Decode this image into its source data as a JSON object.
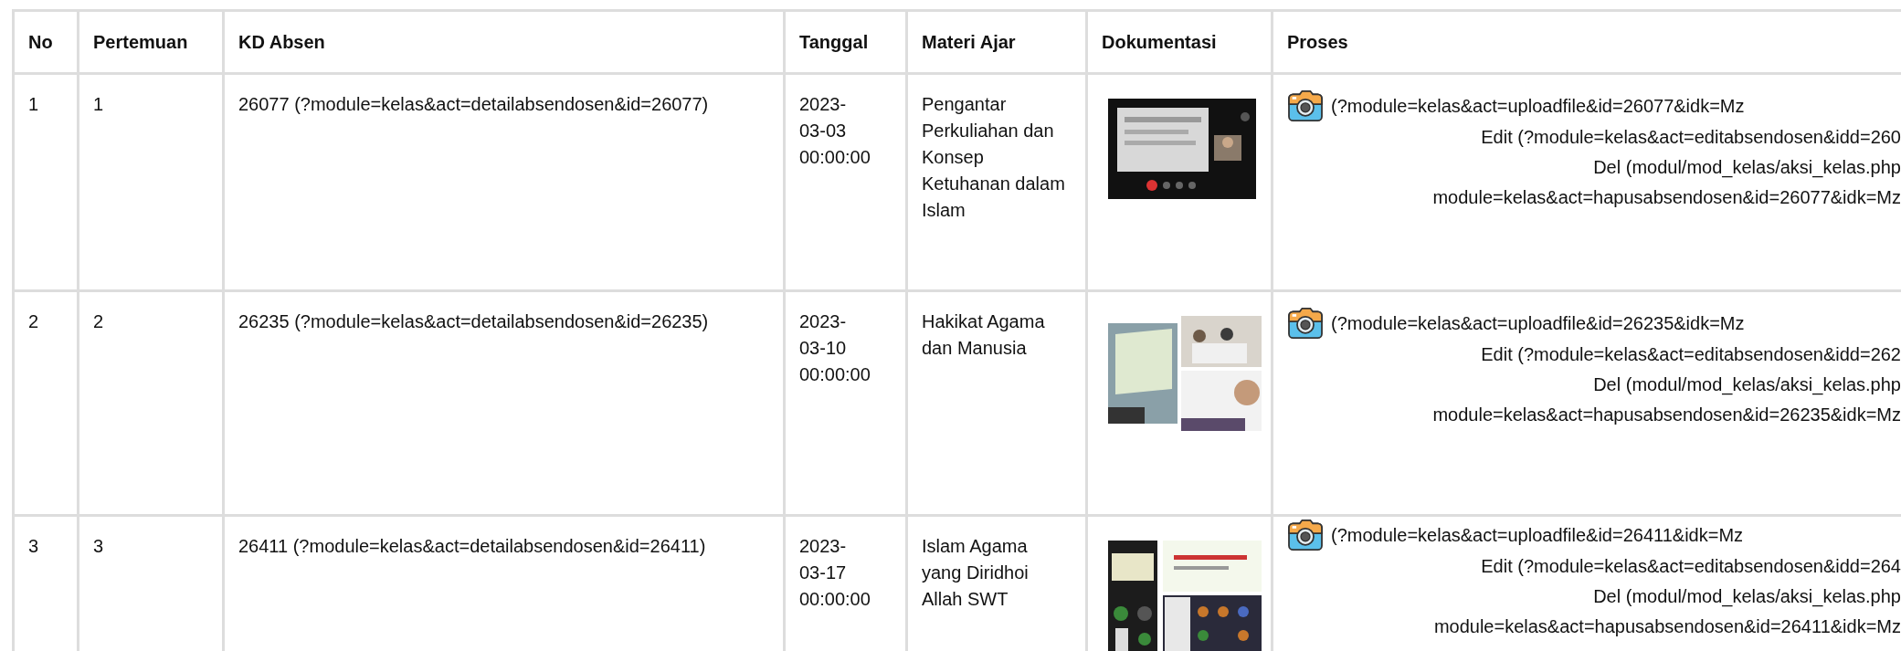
{
  "table": {
    "columns": [
      "No",
      "Pertemuan",
      "KD Absen",
      "Tanggal",
      "Materi Ajar",
      "Dokumentasi",
      "Proses"
    ],
    "rows": [
      {
        "no": "1",
        "pertemuan": "1",
        "kd_absen": "26077 (?module=kelas&act=detailabsendosen&id=26077)",
        "tanggal": "2023-03-03 00:00:00",
        "materi": "Pengantar Perkuliahan dan Konsep Ketuhanan dalam Islam",
        "proses": [
          "(?module=kelas&act=uploadfile&id=26077&idk=Mz",
          "Edit (?module=kelas&act=editabsendosen&idd=260",
          "Del (modul/mod_kelas/aksi_kelas.php",
          "module=kelas&act=hapusabsendosen&id=26077&idk=Mz"
        ]
      },
      {
        "no": "2",
        "pertemuan": "2",
        "kd_absen": "26235 (?module=kelas&act=detailabsendosen&id=26235)",
        "tanggal": "2023-03-10 00:00:00",
        "materi": "Hakikat Agama dan Manusia",
        "proses": [
          "(?module=kelas&act=uploadfile&id=26235&idk=Mz",
          "Edit (?module=kelas&act=editabsendosen&idd=262",
          "Del (modul/mod_kelas/aksi_kelas.php",
          "module=kelas&act=hapusabsendosen&id=26235&idk=Mz"
        ]
      },
      {
        "no": "3",
        "pertemuan": "3",
        "kd_absen": "26411 (?module=kelas&act=detailabsendosen&id=26411)",
        "tanggal": "2023-03-17 00:00:00",
        "materi": "Islam Agama yang Diridhoi Allah SWT",
        "proses": [
          "(?module=kelas&act=uploadfile&id=26411&idk=Mz",
          "Edit (?module=kelas&act=editabsendosen&idd=264",
          "Del (modul/mod_kelas/aksi_kelas.php",
          "module=kelas&act=hapusabsendosen&id=26411&idk=Mz"
        ]
      }
    ]
  }
}
